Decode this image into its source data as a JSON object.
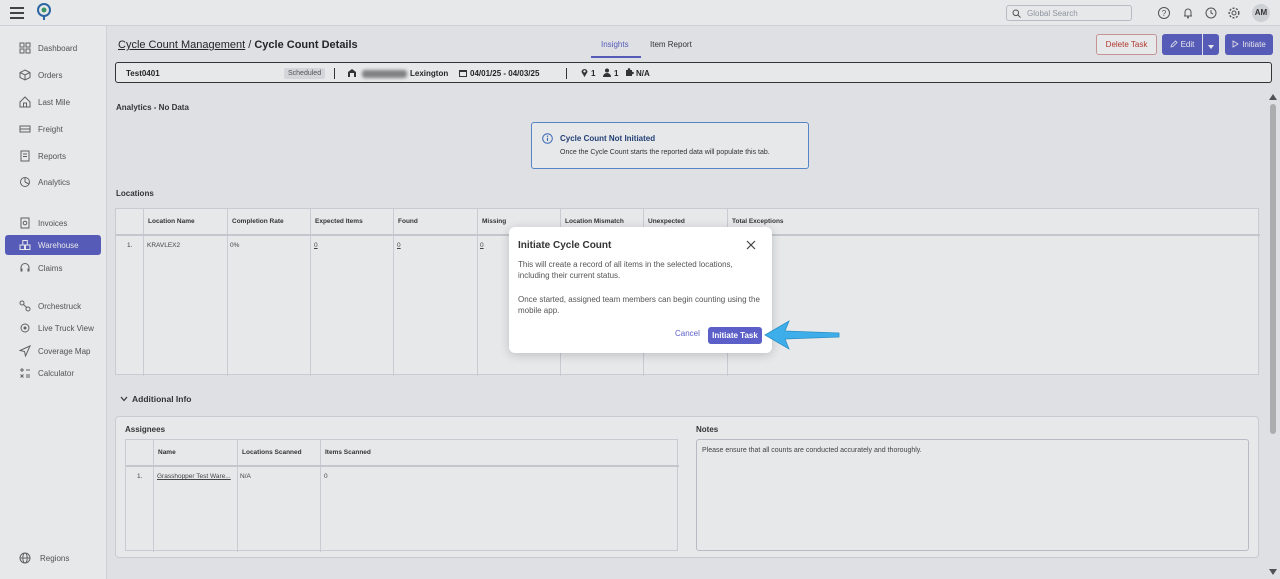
{
  "topbar": {
    "search_placeholder": "Global Search",
    "avatar_initials": "AM"
  },
  "sidebar": {
    "items": [
      {
        "label": "Dashboard"
      },
      {
        "label": "Orders"
      },
      {
        "label": "Last Mile"
      },
      {
        "label": "Freight"
      },
      {
        "label": "Reports"
      },
      {
        "label": "Analytics"
      },
      {
        "label": "Invoices"
      },
      {
        "label": "Warehouse"
      },
      {
        "label": "Claims"
      },
      {
        "label": "Orchestruck"
      },
      {
        "label": "Live Truck View"
      },
      {
        "label": "Coverage Map"
      },
      {
        "label": "Calculator"
      }
    ],
    "footer_label": "Regions"
  },
  "header": {
    "breadcrumb_parent": "Cycle Count Management",
    "breadcrumb_sep": " / ",
    "breadcrumb_current": "Cycle Count Details",
    "tabs": [
      {
        "label": "Insights"
      },
      {
        "label": "Item Report"
      }
    ],
    "delete_label": "Delete Task",
    "edit_label": "Edit",
    "initiate_label": "Initiate"
  },
  "info": {
    "task_name": "Test0401",
    "status": "Scheduled",
    "location": "Lexington",
    "date_range": "04/01/25 - 04/03/25",
    "locations_count": "1",
    "members_count": "1",
    "category": "N/A"
  },
  "analytics": {
    "title": "Analytics - No Data",
    "alert_title": "Cycle Count Not Initiated",
    "alert_text": "Once the Cycle Count starts the reported data will populate this tab."
  },
  "locations": {
    "title": "Locations",
    "headers": [
      "Location Name",
      "Completion Rate",
      "Expected Items",
      "Found",
      "Missing",
      "Location Mismatch",
      "Unexpected",
      "Total Exceptions"
    ],
    "rows": [
      {
        "index": "1.",
        "name": "KRAVLEX2",
        "completion": "0%",
        "expected": "0",
        "found": "0",
        "missing": "0"
      }
    ]
  },
  "additional": {
    "title": "Additional Info",
    "assignees_title": "Assignees",
    "assignees_headers": [
      "Name",
      "Locations Scanned",
      "Items Scanned"
    ],
    "assignees_rows": [
      {
        "index": "1.",
        "name": "Grasshopper Test Ware...",
        "locations": "N/A",
        "items": "0"
      }
    ],
    "notes_title": "Notes",
    "notes_text": "Please ensure that all counts are conducted accurately and thoroughly."
  },
  "modal": {
    "title": "Initiate Cycle Count",
    "text1": "This will create a record of all items in the selected locations, including their current status.",
    "text2": "Once started, assigned team members can begin counting using the mobile app.",
    "cancel_label": "Cancel",
    "confirm_label": "Initiate Task"
  },
  "colors": {
    "accent": "#5b5fc7",
    "danger": "#c0392b",
    "arrow": "#3daee9"
  }
}
